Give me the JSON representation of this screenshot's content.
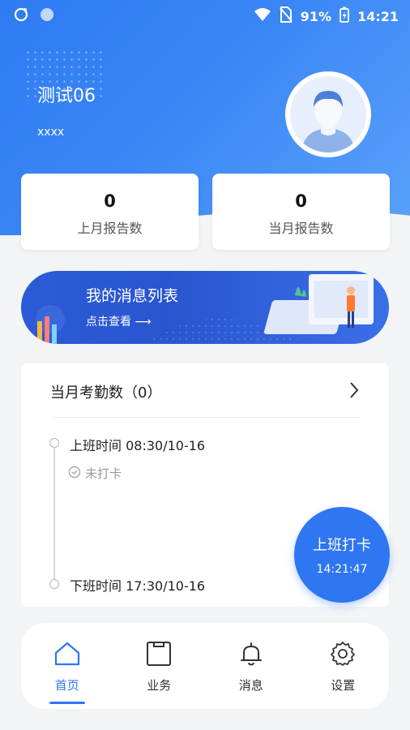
{
  "status_bar": {
    "battery": "91%",
    "time": "14:21"
  },
  "profile": {
    "name": "测试06",
    "subtitle": "xxxx"
  },
  "stats": [
    {
      "value": "0",
      "label": "上月报告数"
    },
    {
      "value": "0",
      "label": "当月报告数"
    }
  ],
  "banner": {
    "title": "我的消息列表",
    "link": "点击查看 ⟶"
  },
  "attendance": {
    "header": "当月考勤数（0）",
    "clock_in": "上班时间 08:30/10-16",
    "clock_in_status": "未打卡",
    "clock_out": "下班时间 17:30/10-16"
  },
  "punch": {
    "label": "上班打卡",
    "time": "14:21:47"
  },
  "tabs": [
    {
      "label": "首页",
      "icon": "home-icon",
      "active": true
    },
    {
      "label": "业务",
      "icon": "clipboard-icon",
      "active": false
    },
    {
      "label": "消息",
      "icon": "bell-icon",
      "active": false
    },
    {
      "label": "设置",
      "icon": "gear-icon",
      "active": false
    }
  ],
  "colors": {
    "accent": "#2e76f2",
    "hero_gradient_start": "#2e7bf3",
    "banner": "#2b5bd8"
  }
}
